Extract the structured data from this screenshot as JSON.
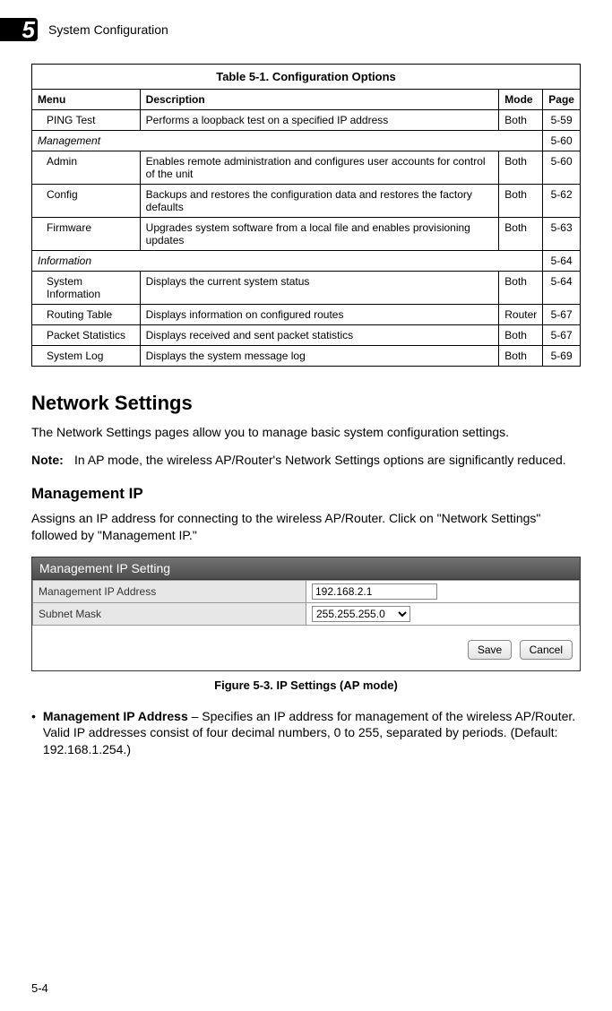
{
  "header": {
    "chapter_number": "5",
    "title": "System Configuration"
  },
  "table": {
    "caption": "Table 5-1. Configuration Options",
    "headers": {
      "menu": "Menu",
      "description": "Description",
      "mode": "Mode",
      "page": "Page"
    },
    "rows": [
      {
        "type": "item",
        "menu": "PING Test",
        "description": "Performs a loopback test on a specified IP address",
        "mode": "Both",
        "page": "5-59"
      },
      {
        "type": "section",
        "menu": "Management",
        "page": "5-60"
      },
      {
        "type": "item",
        "menu": "Admin",
        "description": "Enables remote administration and configures user accounts for control of the unit",
        "mode": "Both",
        "page": "5-60"
      },
      {
        "type": "item",
        "menu": "Config",
        "description": "Backups and restores the configuration data and restores the factory defaults",
        "mode": "Both",
        "page": "5-62"
      },
      {
        "type": "item",
        "menu": "Firmware",
        "description": "Upgrades system software from a local file and enables provisioning updates",
        "mode": "Both",
        "page": "5-63"
      },
      {
        "type": "section",
        "menu": "Information",
        "page": "5-64"
      },
      {
        "type": "item",
        "menu": "System Information",
        "description": "Displays the current system status",
        "mode": "Both",
        "page": "5-64"
      },
      {
        "type": "item",
        "menu": "Routing Table",
        "description": "Displays information on configured routes",
        "mode": "Router",
        "page": "5-67"
      },
      {
        "type": "item",
        "menu": "Packet Statistics",
        "description": "Displays received and sent packet statistics",
        "mode": "Both",
        "page": "5-67"
      },
      {
        "type": "item",
        "menu": "System Log",
        "description": "Displays the system message log",
        "mode": "Both",
        "page": "5-69"
      }
    ]
  },
  "section": {
    "heading": "Network Settings",
    "intro": "The Network Settings pages allow you to manage basic system configuration settings.",
    "note_label": "Note:",
    "note_text": "In AP mode, the wireless AP/Router's Network Settings options are significantly reduced."
  },
  "subsection": {
    "heading": "Management IP",
    "intro": "Assigns an IP address for connecting to the wireless AP/Router. Click on \"Network Settings\" followed by \"Management IP.\""
  },
  "screenshot": {
    "panel_title": "Management IP Setting",
    "rows": {
      "ip": {
        "label": "Management IP Address",
        "value": "192.168.2.1"
      },
      "mask": {
        "label": "Subnet Mask",
        "value": "255.255.255.0"
      }
    },
    "buttons": {
      "save": "Save",
      "cancel": "Cancel"
    }
  },
  "figure_caption": "Figure 5-3.   IP Settings (AP mode)",
  "bullet": {
    "term": "Management IP Address",
    "text": " – Specifies an IP address for management of the wireless AP/Router. Valid IP addresses consist of four decimal numbers, 0 to 255, separated by periods. (Default: 192.168.1.254.)"
  },
  "page_number": "5-4"
}
